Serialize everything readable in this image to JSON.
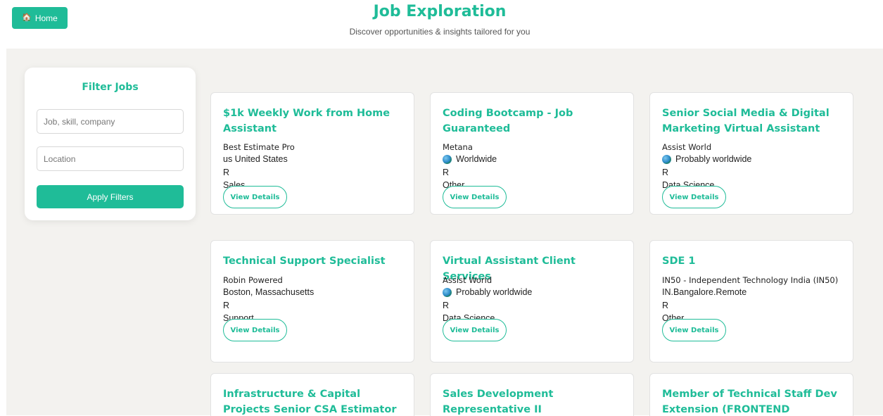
{
  "header": {
    "home_label": "Home",
    "home_icon": "house-icon",
    "title": "Job Exploration",
    "subtitle": "Discover opportunities & insights tailored for you"
  },
  "filters": {
    "title": "Filter Jobs",
    "keyword_placeholder": "Job, skill, company",
    "location_placeholder": "Location",
    "apply_label": "Apply Filters"
  },
  "view_details_label": "View Details",
  "jobs": [
    {
      "title": "$1k Weekly Work from Home Assistant",
      "company": "Best Estimate Pro",
      "location": "us United States",
      "globe": false,
      "type": "R",
      "category": "Sales"
    },
    {
      "title": "Coding Bootcamp - Job Guaranteed",
      "company": "Metana",
      "location": "Worldwide",
      "globe": true,
      "type": "R",
      "category": "Other"
    },
    {
      "title": "Senior Social Media & Digital Marketing Virtual Assistant",
      "company": "Assist World",
      "location": "Probably worldwide",
      "globe": true,
      "type": "R",
      "category": "Data Science"
    },
    {
      "title": "Technical Support Specialist",
      "company": "Robin Powered",
      "location": "Boston, Massachusetts",
      "globe": false,
      "type": "R",
      "category": "Support"
    },
    {
      "title": "Virtual Assistant Client Services",
      "company": "Assist World",
      "location": "Probably worldwide",
      "globe": true,
      "type": "R",
      "category": "Data Science"
    },
    {
      "title": "SDE 1",
      "company": "IN50 - Independent Technology India (IN50)",
      "location": "IN.Bangalore.Remote",
      "globe": false,
      "type": "R",
      "category": "Other"
    },
    {
      "title": "Infrastructure & Capital Projects Senior CSA Estimator ANS"
    },
    {
      "title": "Sales Development Representative II"
    },
    {
      "title": "Member of Technical Staff Dev Extension (FRONTEND"
    }
  ],
  "colors": {
    "accent": "#1fbc98",
    "background": "#f3f2ef"
  }
}
